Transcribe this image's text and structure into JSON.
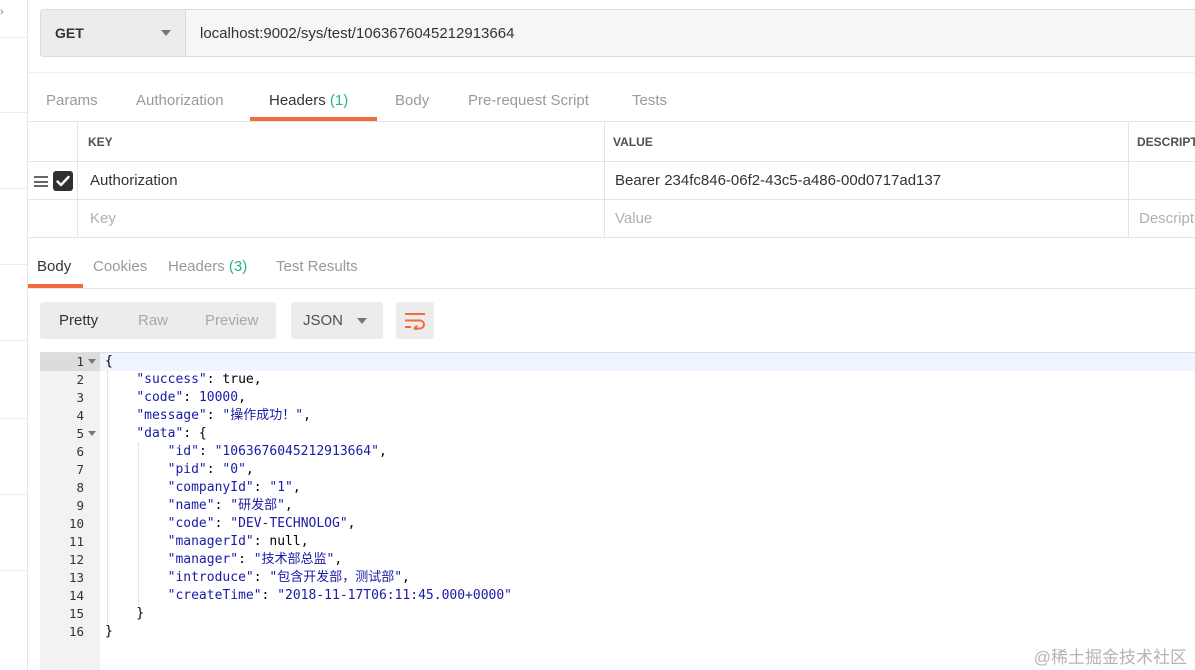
{
  "request": {
    "method": "GET",
    "url": "localhost:9002/sys/test/1063676045212913664"
  },
  "request_tabs": [
    {
      "label": "Params"
    },
    {
      "label": "Authorization"
    },
    {
      "label": "Headers",
      "count": "(1)"
    },
    {
      "label": "Body"
    },
    {
      "label": "Pre-request Script"
    },
    {
      "label": "Tests"
    }
  ],
  "headers_table": {
    "columns": [
      "KEY",
      "VALUE",
      "DESCRIPT"
    ],
    "rows": [
      {
        "key": "Authorization",
        "value": "Bearer 234fc846-06f2-43c5-a486-00d0717ad137",
        "checked": true
      }
    ],
    "placeholder": {
      "key": "Key",
      "value": "Value",
      "description": "Descript"
    }
  },
  "response_tabs": [
    {
      "label": "Body"
    },
    {
      "label": "Cookies"
    },
    {
      "label": "Headers",
      "count": "(3)"
    },
    {
      "label": "Test Results"
    }
  ],
  "view_modes": [
    "Pretty",
    "Raw",
    "Preview"
  ],
  "format": "JSON",
  "line_numbers": [
    "1",
    "2",
    "3",
    "4",
    "5",
    "6",
    "7",
    "8",
    "9",
    "10",
    "11",
    "12",
    "13",
    "14",
    "15",
    "16"
  ],
  "response_body": {
    "success": "true",
    "code": "10000",
    "message": "\"操作成功！\"",
    "data": {
      "id": "\"1063676045212913664\"",
      "pid": "\"0\"",
      "companyId": "\"1\"",
      "name": "\"研发部\"",
      "code": "\"DEV-TECHNOLOG\"",
      "managerId": "null",
      "manager": "\"技术部总监\"",
      "introduce": "\"包含开发部，测试部\"",
      "createTime": "\"2018-11-17T06:11:45.000+0000\""
    }
  },
  "watermark": "@稀土掘金技术社区",
  "colors": {
    "accent": "#f26b3a",
    "count": "#26b47f",
    "json_value": "#1a1aa6"
  }
}
